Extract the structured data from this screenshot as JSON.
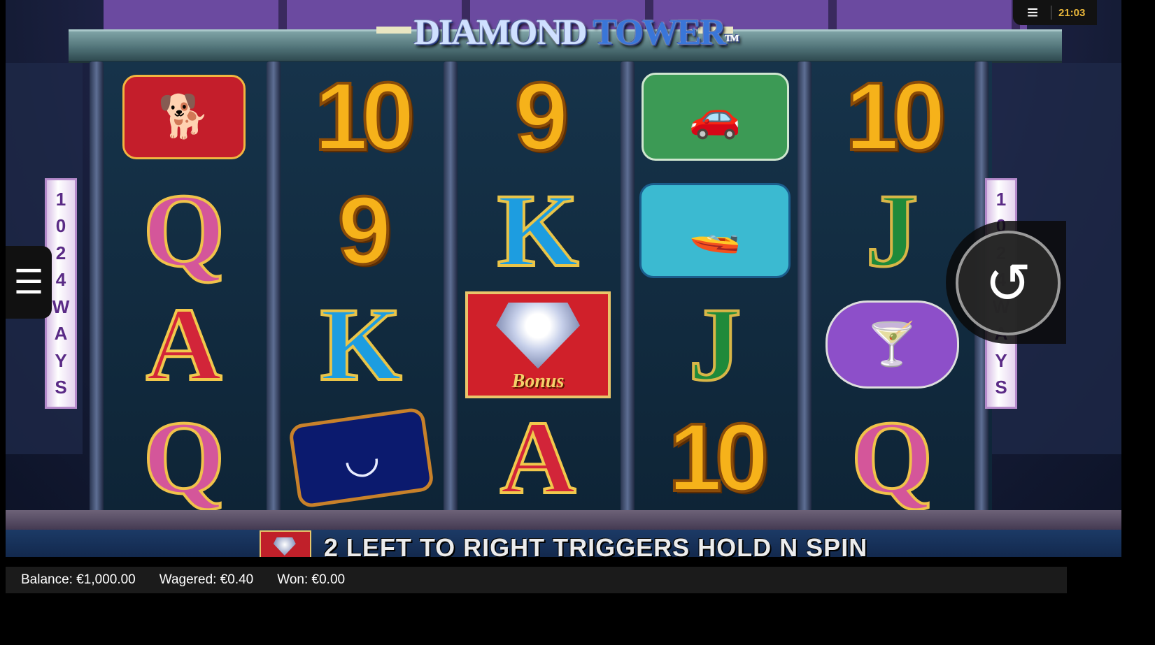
{
  "logo": {
    "word1": "DIAMOND",
    "word2": "TOWER",
    "tm": "TM"
  },
  "ways_label": [
    "1",
    "0",
    "2",
    "4",
    "W",
    "A",
    "Y",
    "S"
  ],
  "reels": [
    [
      "dog",
      "Q",
      "A",
      "Q"
    ],
    [
      "10",
      "9",
      "K",
      "necklace"
    ],
    [
      "9",
      "K",
      "bonus",
      "A"
    ],
    [
      "car",
      "boat",
      "J",
      "10"
    ],
    [
      "10",
      "J",
      "martini",
      "Q"
    ]
  ],
  "bonus_symbol_text": "Bonus",
  "banner": {
    "text": "2 LEFT TO RIGHT TRIGGERS HOLD N SPIN"
  },
  "status": {
    "balance": "Balance: €1,000.00",
    "wagered": "Wagered: €0.40",
    "won": "Won: €0.00"
  },
  "topbar": {
    "clock": "21:03"
  },
  "icons": {
    "menu": "list-icon",
    "hamburger": "hamburger-icon",
    "spin": "spin-icon"
  }
}
